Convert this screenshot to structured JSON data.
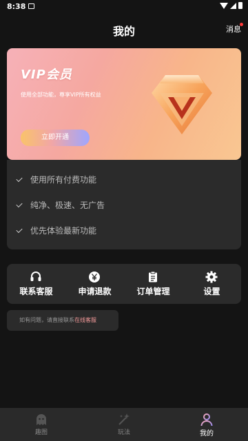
{
  "status_bar": {
    "time": "8:38"
  },
  "header": {
    "title": "我的",
    "message_label": "消息"
  },
  "vip": {
    "title": "VIP会员",
    "description": "使用全部功能，尊享VIP所有权益",
    "open_button": "立即开通"
  },
  "benefits": [
    "使用所有付费功能",
    "纯净、极速、无广告",
    "优先体验最新功能"
  ],
  "services": [
    {
      "label": "联系客服",
      "icon": "headset-icon"
    },
    {
      "label": "申请退款",
      "icon": "yen-icon"
    },
    {
      "label": "订单管理",
      "icon": "clipboard-icon"
    },
    {
      "label": "设置",
      "icon": "gear-icon"
    }
  ],
  "tip": {
    "text": "如有问题，请直接联系",
    "link": "在线客服"
  },
  "bottom_nav": {
    "items": [
      {
        "label": "趣图",
        "icon": "ghost-icon"
      },
      {
        "label": "玩法",
        "icon": "sparkle-icon"
      },
      {
        "label": "我的",
        "icon": "person-icon"
      }
    ],
    "active": "我的"
  },
  "colors": {
    "background": "#141414",
    "card": "#2b2b2b",
    "accent_pink": "#f39a9a",
    "badge_red": "#ff3b3b"
  }
}
